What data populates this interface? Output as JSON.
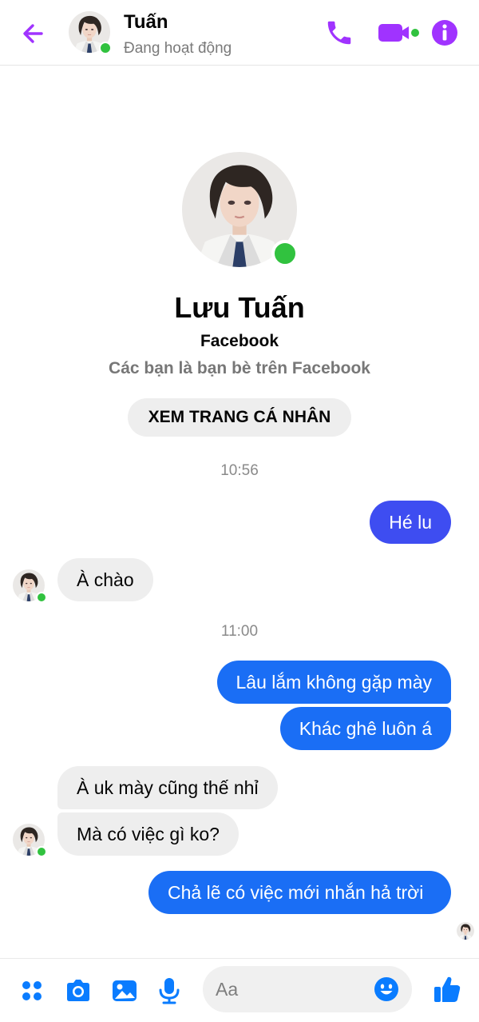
{
  "header": {
    "name": "Tuấn",
    "status": "Đang hoạt động",
    "icons": [
      "back-arrow-icon",
      "phone-icon",
      "video-camera-icon",
      "info-icon"
    ]
  },
  "profile": {
    "name": "Lưu Tuấn",
    "source": "Facebook",
    "relation": "Các bạn là bạn bè trên Facebook",
    "view_profile_label": "XEM TRANG CÁ NHÂN"
  },
  "messages": {
    "time1": "10:56",
    "m1": "Hé lu",
    "m2": "À chào",
    "time2": "11:00",
    "m3": "Lâu lắm không gặp mày",
    "m4": "Khác ghê luôn á",
    "m5": "À uk mày cũng thế nhỉ",
    "m6": "Mà có việc gì ko?",
    "m7": "Chả lẽ có việc mới nhắn hả trời"
  },
  "composer": {
    "placeholder": "Aa",
    "icons": [
      "apps-grid-icon",
      "camera-icon",
      "photo-gallery-icon",
      "microphone-icon",
      "emoji-icon",
      "thumbs-up-icon"
    ]
  },
  "colors": {
    "accent": "#a033ff",
    "messenger_blue": "#0a7cff",
    "outgoing_bubble": "#3e4df1",
    "incoming_bubble": "#eeeeee",
    "online": "#31c23f"
  }
}
